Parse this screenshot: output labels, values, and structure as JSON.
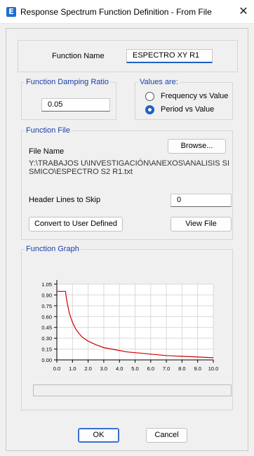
{
  "window": {
    "icon_letter": "E",
    "title": "Response Spectrum Function Definition - From File",
    "close_glyph": "✕"
  },
  "function_name": {
    "label": "Function Name",
    "value": "ESPECTRO XY R1"
  },
  "damping": {
    "title": "Function Damping Ratio",
    "value": "0.05"
  },
  "values_are": {
    "title": "Values are:",
    "options": [
      {
        "label": "Frequency vs Value",
        "checked": false
      },
      {
        "label": "Period vs Value",
        "checked": true
      }
    ]
  },
  "function_file": {
    "title": "Function File",
    "browse_label": "Browse...",
    "file_name_label": "File Name",
    "file_path": "Y:\\TRABAJOS U\\INVESTIGACIÓN\\ANEXOS\\ANALISIS SISMICO\\ESPECTRO S2 R1.txt",
    "header_lines_label": "Header Lines to Skip",
    "header_lines_value": "0",
    "convert_label": "Convert to User Defined",
    "view_file_label": "View File"
  },
  "function_graph": {
    "title": "Function Graph"
  },
  "buttons": {
    "ok": "OK",
    "cancel": "Cancel"
  },
  "colors": {
    "accent": "#1f5fc8",
    "group_title": "#1a3ea8",
    "curve": "#cc0000"
  },
  "chart_data": {
    "type": "line",
    "title": "",
    "xlabel": "",
    "ylabel": "",
    "xlim": [
      0,
      10
    ],
    "ylim": [
      0,
      1.05
    ],
    "x_ticks": [
      "0.0",
      "1.0",
      "2.0",
      "3.0",
      "4.0",
      "5.0",
      "6.0",
      "7.0",
      "8.0",
      "9.0",
      "10.0"
    ],
    "y_ticks": [
      "0.00",
      "0.15",
      "0.30",
      "0.45",
      "0.60",
      "0.75",
      "0.90",
      "1.05"
    ],
    "grid": true,
    "series": [
      {
        "x": [
          0,
          0.55,
          0.6,
          0.7,
          0.8,
          0.9,
          1.0,
          1.2,
          1.4,
          1.6,
          1.8,
          2.0,
          2.5,
          3.0,
          3.5,
          4.0,
          4.5,
          5.0,
          5.5,
          6.0,
          7.0,
          8.0,
          9.0,
          10.0
        ],
        "y": [
          0.95,
          0.95,
          0.87,
          0.75,
          0.65,
          0.58,
          0.52,
          0.43,
          0.37,
          0.32,
          0.29,
          0.26,
          0.21,
          0.17,
          0.15,
          0.13,
          0.11,
          0.1,
          0.09,
          0.08,
          0.06,
          0.05,
          0.04,
          0.03
        ]
      }
    ]
  }
}
